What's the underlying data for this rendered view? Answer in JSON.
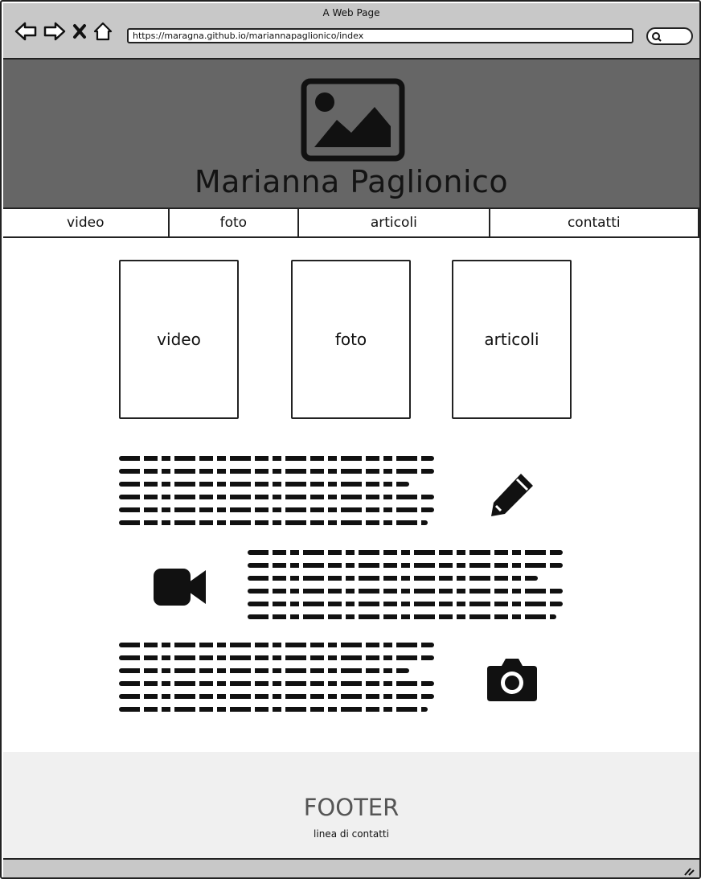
{
  "window": {
    "title": "A Web Page",
    "url": "https://maragna.github.io/mariannapaglionico/index",
    "icons": [
      "back-arrow-icon",
      "forward-arrow-icon",
      "close-icon",
      "home-icon",
      "search-icon"
    ]
  },
  "header": {
    "logo_icon": "image-placeholder-icon",
    "title": "Marianna Paglionico",
    "background": "#666666"
  },
  "nav": {
    "items": [
      {
        "label": "video"
      },
      {
        "label": "foto"
      },
      {
        "label": "articoli"
      },
      {
        "label": "contatti"
      }
    ]
  },
  "cards": [
    {
      "label": "video"
    },
    {
      "label": "foto"
    },
    {
      "label": "articoli"
    }
  ],
  "features": [
    {
      "icon": "pencil-icon",
      "text_lines": 6
    },
    {
      "icon": "video-camera-icon",
      "text_lines": 6
    },
    {
      "icon": "photo-camera-icon",
      "text_lines": 6
    }
  ],
  "footer": {
    "title": "FOOTER",
    "subtitle": "linea di contatti",
    "background": "#f0f0f0"
  }
}
